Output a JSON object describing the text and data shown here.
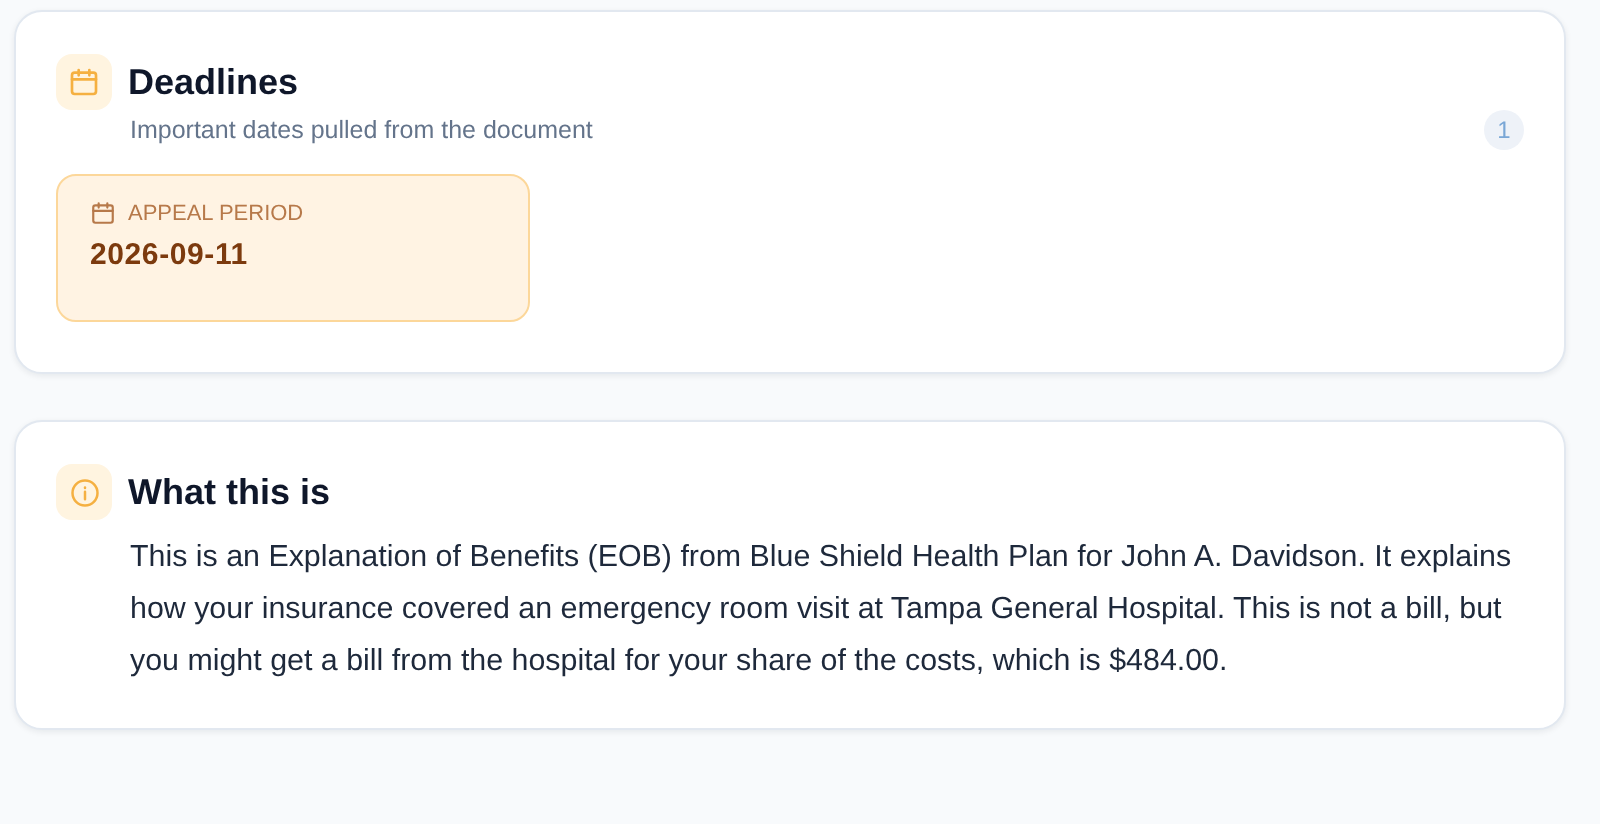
{
  "deadlines": {
    "title": "Deadlines",
    "subtitle": "Important dates pulled from the document",
    "count": "1",
    "items": [
      {
        "label": "APPEAL PERIOD",
        "date": "2026-09-11"
      }
    ]
  },
  "summary": {
    "title": "What this is",
    "text": "This is an Explanation of Benefits (EOB) from Blue Shield Health Plan for John A. Davidson. It explains how your insurance covered an emergency room visit at Tampa General Hospital. This is not a bill, but you might get a bill from the hospital for your share of the costs, which is $484.00."
  }
}
